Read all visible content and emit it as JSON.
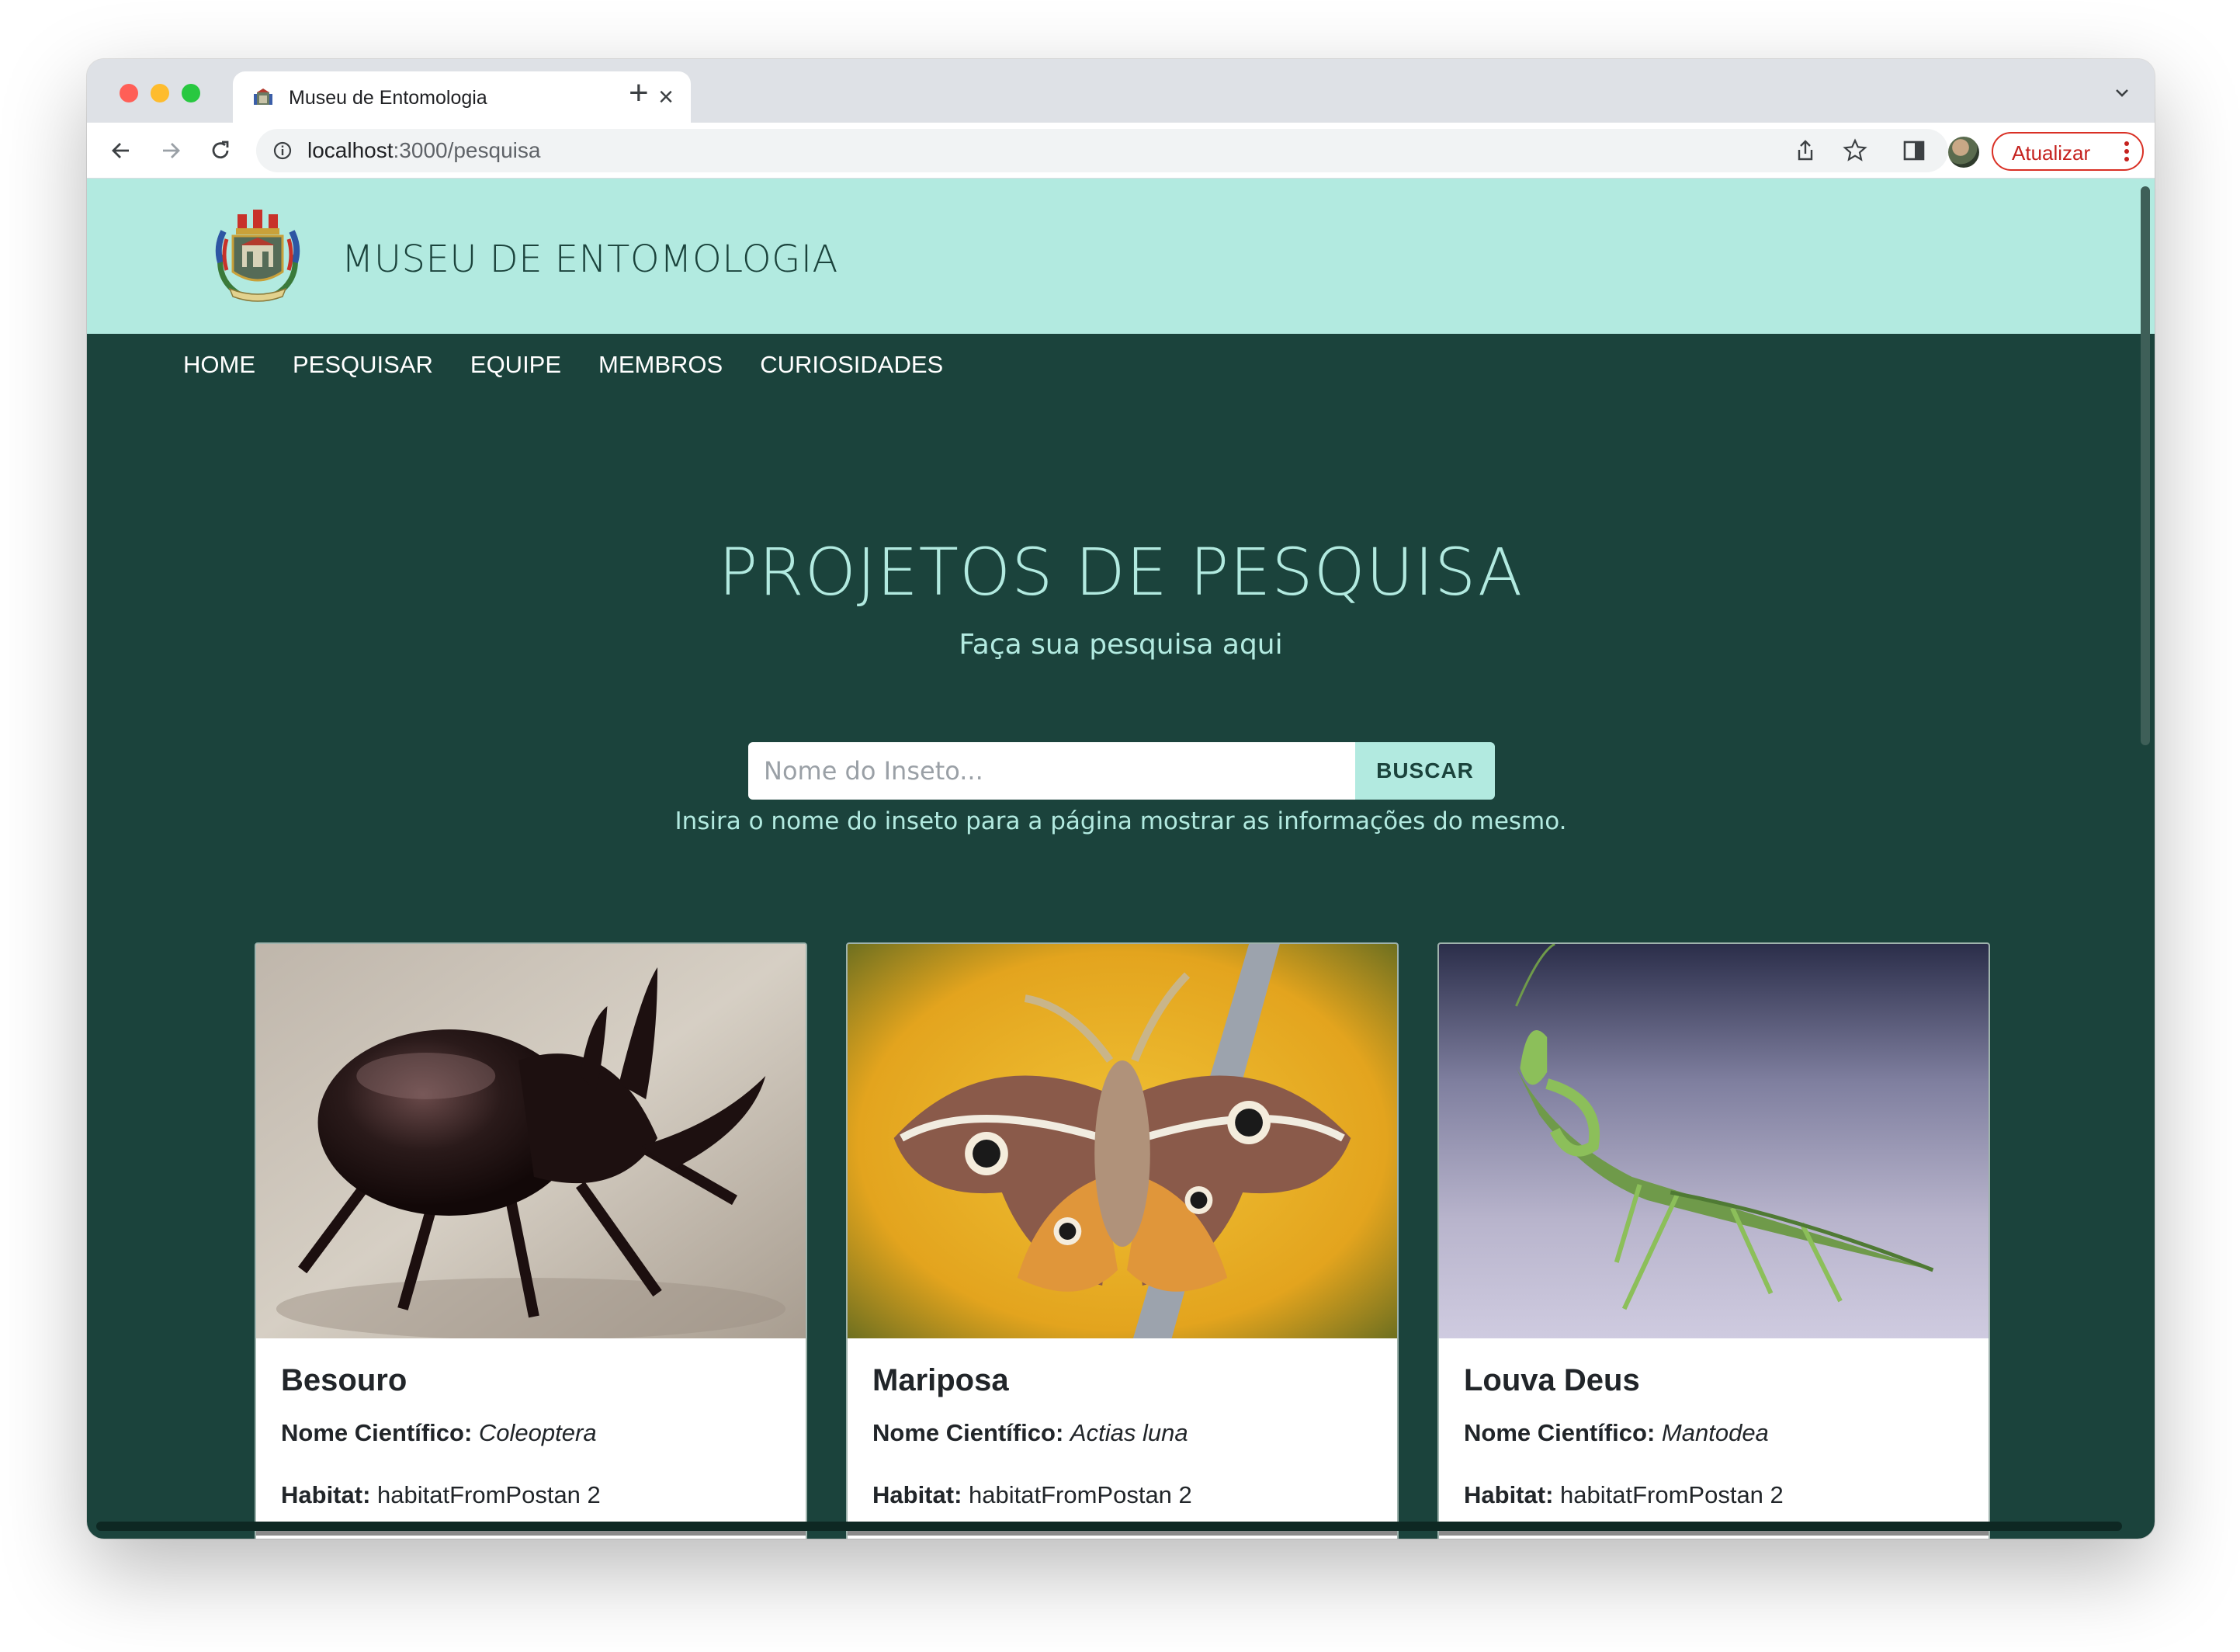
{
  "browser": {
    "tab_title": "Museu de Entomologia",
    "tab_close": "×",
    "new_tab": "+",
    "url_host": "localhost",
    "url_path": ":3000/pesquisa",
    "update_label": "Atualizar"
  },
  "header": {
    "brand": "MUSEU DE ENTOMOLOGIA"
  },
  "nav": {
    "items": [
      "HOME",
      "PESQUISAR",
      "EQUIPE",
      "MEMBROS",
      "CURIOSIDADES"
    ]
  },
  "hero": {
    "title": "PROJETOS DE PESQUISA",
    "subtitle": "Faça sua pesquisa aqui"
  },
  "search": {
    "placeholder": "Nome do Inseto...",
    "button_label": "BUSCAR",
    "help_text": "Insira o nome do inseto para a página mostrar as informações do mesmo."
  },
  "cards": [
    {
      "name": "Besouro",
      "sci_label": "Nome Científico:",
      "sci_value": "Coleoptera",
      "habitat_label": "Habitat:",
      "habitat_value": "habitatFromPostan 2"
    },
    {
      "name": "Mariposa",
      "sci_label": "Nome Científico:",
      "sci_value": "Actias luna",
      "habitat_label": "Habitat:",
      "habitat_value": "habitatFromPostan 2"
    },
    {
      "name": "Louva Deus",
      "sci_label": "Nome Científico:",
      "sci_value": "Mantodea",
      "habitat_label": "Habitat:",
      "habitat_value": "habitatFromPostan 2"
    }
  ],
  "colors": {
    "header_bg": "#b2eae0",
    "page_bg": "#1b433c",
    "accent": "#b2eae0"
  }
}
